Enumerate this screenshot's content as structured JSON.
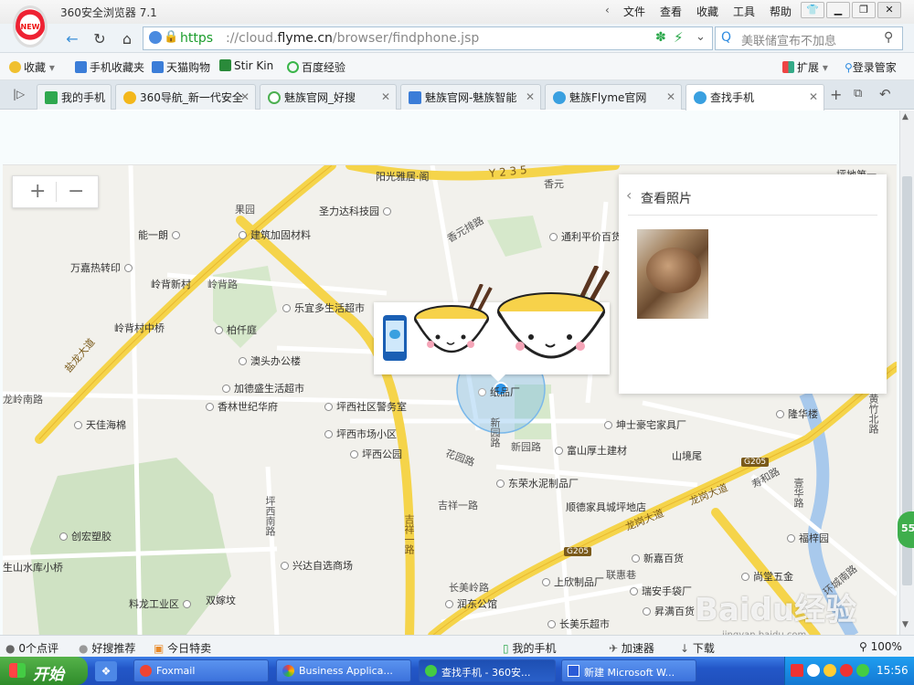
{
  "window": {
    "title": "360安全浏览器 7.1",
    "logo_text": "NEW",
    "menu": [
      "文件",
      "查看",
      "收藏",
      "工具",
      "帮助"
    ]
  },
  "address": {
    "https": "https",
    "url_prefix": "://cloud.",
    "url_domain": "flyme.cn",
    "url_path": "/browser/findphone.jsp",
    "search_placeholder": "美联储宣布不加息"
  },
  "bookmarks": {
    "favorites": "收藏",
    "items": [
      "手机收藏夹",
      "天猫购物",
      "Stir Kin",
      "百度经验"
    ],
    "extensions": "扩展",
    "login": "登录管家"
  },
  "tabs": [
    {
      "label": "我的手机",
      "color": "#2fa84f"
    },
    {
      "label": "360导航_新一代安全",
      "color": "#f3b71b"
    },
    {
      "label": "魅族官网_好搜",
      "color": "#4caf50"
    },
    {
      "label": "魅族官网-魅族智能",
      "color": "#3b7dd8"
    },
    {
      "label": "魅族Flyme官网",
      "color": "#3aa0e0"
    },
    {
      "label": "查找手机",
      "color": "#3aa0e0"
    }
  ],
  "map": {
    "zoom_in": "+",
    "zoom_out": "−",
    "places": [
      "阳光雅居·阁",
      "圣力达科技园",
      "能一朗",
      "建筑加固材料",
      "万嘉热转印",
      "岭背新村",
      "岭背村中桥",
      "乐宜多生活超市",
      "柏仟庭",
      "澳头办公楼",
      "加德盛生活超市",
      "香林世纪华府",
      "天佳海棉",
      "坪西社区警务室",
      "坪西市场小区",
      "坪西公园",
      "东荣水泥制品厂",
      "通利平价百货",
      "坤士豪宅家具厂",
      "富山厚土建材",
      "顺德家具城坪地店",
      "新嘉百货",
      "上欣制品厂",
      "瑞安手袋厂",
      "昇满百货",
      "长美乐超市",
      "润东公馆",
      "创宏塑胶",
      "兴达自选商场",
      "双嫁坟",
      "料龙工业区",
      "生山水库小桥",
      "尚堂五金",
      "福梓园",
      "隆华楼",
      "坪地第一",
      "山境尾",
      "纸品厂"
    ],
    "roads": [
      "龙岭南路",
      "盐龙大道",
      "坪西南路",
      "吉祥一路",
      "花园路",
      "新园路",
      "吉祥一路",
      "长美岭路",
      "龙岗大道",
      "龙岗大道",
      "寿和路",
      "环城南路",
      "黄竹北路",
      "香元排路",
      "香元",
      "联惠巷",
      "新园路",
      "壹华路",
      "果园",
      "岭背路"
    ],
    "highway_labels": [
      "Y 2 3 5",
      "G205",
      "G205"
    ]
  },
  "photo_panel": {
    "title": "查看照片"
  },
  "statusbar": {
    "reviews": "0个点评",
    "recommend": "好搜推荐",
    "deals": "今日特卖",
    "my_phone": "我的手机",
    "accelerator": "加速器",
    "download": "下载",
    "zoom": "100%"
  },
  "taskbar": {
    "start": "开始",
    "tasks": [
      "Foxmail",
      "Business Applica...",
      "查找手机 - 360安...",
      "新建 Microsoft W..."
    ],
    "clock": "15:56"
  },
  "watermark": {
    "brand": "Baidu经验",
    "url": "jingyan.baidu.com"
  }
}
